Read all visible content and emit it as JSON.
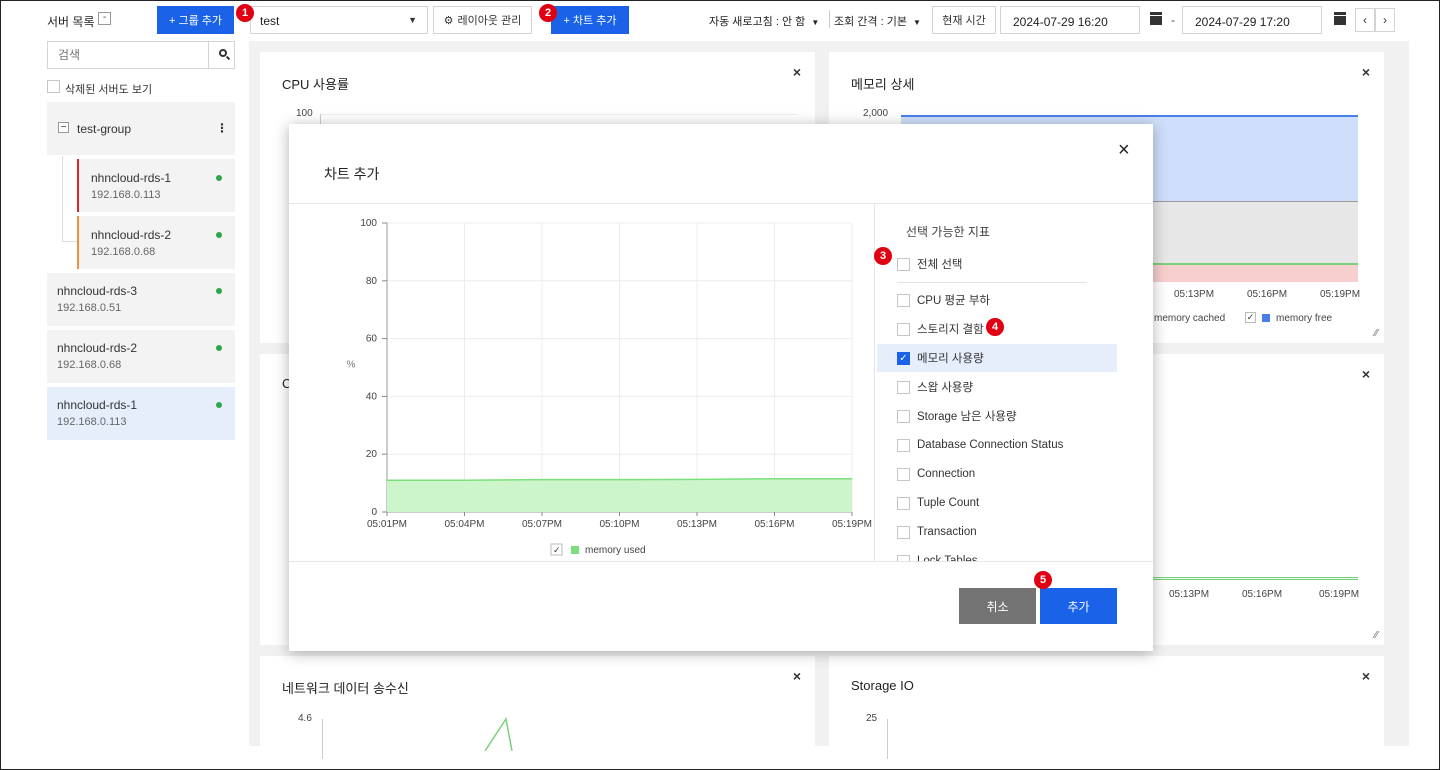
{
  "toolbar": {
    "server_list_label": "서버 목록",
    "collapse_symbol": "-",
    "add_group_label": "+ 그룹 추가",
    "layout_select_value": "test",
    "layout_manage_label": "레이아웃 관리",
    "add_chart_label": "+ 차트 추가",
    "auto_refresh_label": "자동 새로고침 : 안 함",
    "interval_label": "조회 간격 : 기본",
    "current_time_label": "현재 시간",
    "date_from": "2024-07-29 16:20",
    "date_separator": "-",
    "date_to": "2024-07-29 17:20"
  },
  "badges": [
    "1",
    "2",
    "3",
    "4",
    "5"
  ],
  "sidebar": {
    "search_placeholder": "검색",
    "show_deleted_label": "삭제된 서버도 보기",
    "group_toggle": "−",
    "group_name": "test-group",
    "group_menu": "⋮",
    "group_servers": [
      {
        "name": "nhncloud-rds-1",
        "ip": "192.168.0.113",
        "color": "#d52b2b"
      },
      {
        "name": "nhncloud-rds-2",
        "ip": "192.168.0.68",
        "color": "#f0923a"
      }
    ],
    "servers": [
      {
        "name": "nhncloud-rds-3",
        "ip": "192.168.0.51"
      },
      {
        "name": "nhncloud-rds-2",
        "ip": "192.168.0.68"
      },
      {
        "name": "nhncloud-rds-1",
        "ip": "192.168.0.113"
      }
    ],
    "status_color": "#2fa54a"
  },
  "panels": {
    "cpu_title": "CPU 사용률",
    "cpu_ytick": "100",
    "memory_title": "메모리 상세",
    "memory_ytick": "2,000",
    "memory_xticks": [
      "05:13PM",
      "05:16PM",
      "05:19PM"
    ],
    "memory_legend_cached": "memory cached",
    "memory_legend_free": "memory free",
    "mid_left_partial": "C",
    "mid_right_xticks": [
      "05:13PM",
      "05:16PM",
      "05:19PM"
    ],
    "network_title": "네트워크 데이터 송수신",
    "network_ytick": "4.6",
    "storage_io_title": "Storage IO",
    "storage_io_ytick": "25",
    "close_symbol": "×",
    "resize_symbol": "⁄⁄"
  },
  "modal": {
    "title": "차트 추가",
    "close_symbol": "×",
    "metrics_heading": "선택 가능한 지표",
    "select_all_label": "전체 선택",
    "metrics": [
      {
        "label": "CPU 평균 부하",
        "checked": false
      },
      {
        "label": "스토리지 결함",
        "checked": false
      },
      {
        "label": "메모리 사용량",
        "checked": true
      },
      {
        "label": "스왑 사용량",
        "checked": false
      },
      {
        "label": "Storage 남은 사용량",
        "checked": false
      },
      {
        "label": "Database Connection Status",
        "checked": false
      },
      {
        "label": "Connection",
        "checked": false
      },
      {
        "label": "Tuple Count",
        "checked": false
      },
      {
        "label": "Transaction",
        "checked": false
      },
      {
        "label": "Lock Tables",
        "checked": false
      }
    ],
    "cancel_label": "취소",
    "add_label": "추가"
  },
  "chart_data": {
    "type": "area",
    "title": "",
    "xlabel": "",
    "ylabel": "%",
    "x": [
      "05:01PM",
      "05:04PM",
      "05:07PM",
      "05:10PM",
      "05:13PM",
      "05:16PM",
      "05:19PM"
    ],
    "yticks": [
      0,
      20,
      40,
      60,
      80,
      100
    ],
    "ylim": [
      0,
      100
    ],
    "series": [
      {
        "name": "memory used",
        "values": [
          11,
          11,
          11.2,
          11.2,
          11.3,
          11.5,
          11.5
        ],
        "color": "#7be07b"
      }
    ],
    "grid": true,
    "legend": "bottom"
  }
}
